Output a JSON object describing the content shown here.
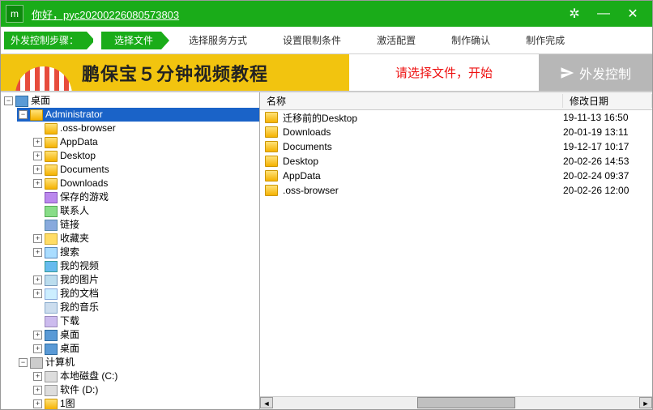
{
  "title": {
    "greeting": "你好，pyc20200226080573803"
  },
  "steps": {
    "label": "外发控制步骤：",
    "items": [
      "选择文件",
      "选择服务方式",
      "设置限制条件",
      "激活配置",
      "制作确认",
      "制作完成"
    ]
  },
  "banner": {
    "promo": "鹏保宝５分钟视频教程",
    "message": "请选择文件，开始",
    "action": "外发控制"
  },
  "list": {
    "header": {
      "name": "名称",
      "date": "修改日期"
    },
    "rows": [
      {
        "name": "迁移前的Desktop",
        "date": "19-11-13 16:50"
      },
      {
        "name": "Downloads",
        "date": "20-01-19 13:11"
      },
      {
        "name": "Documents",
        "date": "19-12-17 10:17"
      },
      {
        "name": "Desktop",
        "date": "20-02-26 14:53"
      },
      {
        "name": "AppData",
        "date": "20-02-24 09:37"
      },
      {
        "name": ".oss-browser",
        "date": "20-02-26 12:00"
      }
    ]
  },
  "tree": {
    "root1": "桌面",
    "admin": "Administrator",
    "items": [
      ".oss-browser",
      "AppData",
      "Desktop",
      "Documents",
      "Downloads",
      "保存的游戏",
      "联系人",
      "链接",
      "收藏夹",
      "搜索",
      "我的视频",
      "我的图片",
      "我的文档",
      "我的音乐",
      "下载",
      "桌面",
      "桌面"
    ],
    "root2": "计算机",
    "drives": [
      "本地磁盘 (C:)",
      "软件 (D:)",
      "1图"
    ]
  }
}
